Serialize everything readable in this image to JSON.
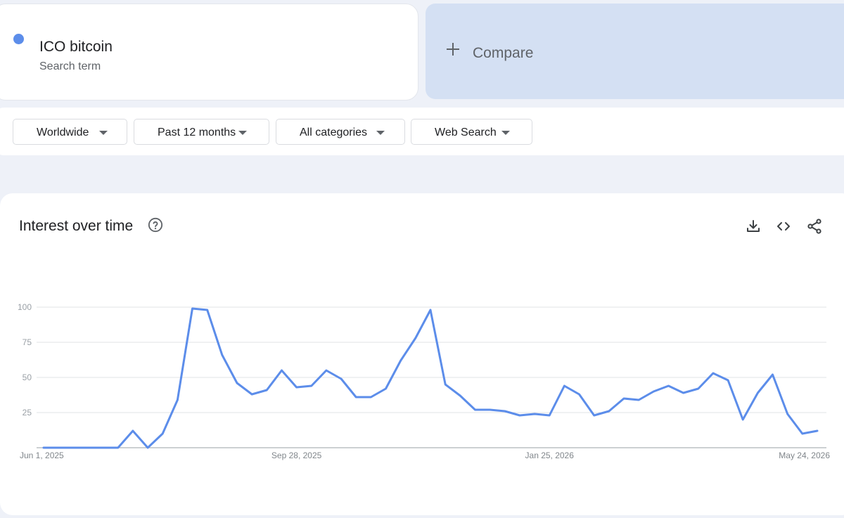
{
  "search_term": {
    "name": "ICO bitcoin",
    "type_label": "Search term",
    "color": "#5c8dea"
  },
  "compare": {
    "label": "Compare"
  },
  "filters": [
    {
      "label": "Worldwide"
    },
    {
      "label": "Past 12 months"
    },
    {
      "label": "All categories"
    },
    {
      "label": "Web Search"
    }
  ],
  "panel": {
    "title": "Interest over time"
  },
  "icons": {
    "help": "help-circle-icon",
    "download": "download-icon",
    "embed": "embed-code-icon",
    "share": "share-icon"
  },
  "chart_data": {
    "type": "line",
    "title": "",
    "xlabel": "",
    "ylabel": "",
    "ylim": [
      0,
      100
    ],
    "y_ticks": [
      25,
      50,
      75,
      100
    ],
    "x_tick_labels": [
      "Jun 1, 2025",
      "Sep 28, 2025",
      "Jan 25, 2026",
      "May 24, 2026"
    ],
    "x_tick_index": [
      0,
      17,
      34,
      52
    ],
    "grid": true,
    "line_color": "#5c8dea",
    "series": [
      {
        "values": [
          0,
          0,
          0,
          0,
          0,
          0,
          12,
          0,
          10,
          34,
          99,
          98,
          66,
          46,
          38,
          41,
          55,
          43,
          44,
          55,
          49,
          36,
          36,
          42,
          62,
          78,
          98,
          45,
          37,
          27,
          27,
          26,
          23,
          24,
          23,
          44,
          38,
          23,
          26,
          35,
          34,
          40,
          44,
          39,
          42,
          53,
          48,
          20,
          39,
          52,
          24,
          10,
          12
        ]
      }
    ]
  }
}
